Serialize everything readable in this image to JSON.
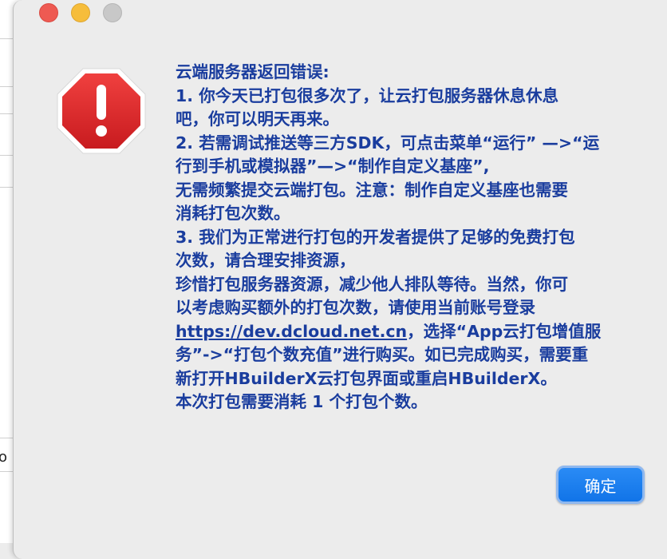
{
  "window": {
    "controls": [
      "close",
      "minimize",
      "zoom"
    ]
  },
  "background": {
    "partial_letter": "o"
  },
  "alert": {
    "icon": "stop-warning-icon",
    "lines": [
      {
        "text": "云端服务器返回错误:"
      },
      {
        "text": "1. 你今天已打包很多次了，让云打包服务器休息休息"
      },
      {
        "text": "吧，你可以明天再来。"
      },
      {
        "text": "2. 若需调试推送等三方SDK，可点击菜单“运行” —>“运"
      },
      {
        "text": "行到手机或模拟器”—>“制作自定义基座”,"
      },
      {
        "text": "无需频繁提交云端打包。注意：制作自定义基座也需要"
      },
      {
        "text": "消耗打包次数。"
      },
      {
        "text": "3. 我们为正常进行打包的开发者提供了足够的免费打包"
      },
      {
        "text": "次数，请合理安排资源，"
      },
      {
        "text": "珍惜打包服务器资源，减少他人排队等待。当然，你可"
      },
      {
        "text": "以考虑购买额外的打包次数，请使用当前账号登录"
      }
    ],
    "link_line": {
      "link": "https://dev.dcloud.net.cn",
      "after": "，选择“App云打包增值服"
    },
    "tail_lines": [
      {
        "text": "务”->“打包个数充值”进行购买。如已完成购买，需要重"
      },
      {
        "text": "新打开HBuilderX云打包界面或重启HBuilderX。"
      },
      {
        "text": "本次打包需要消耗 1 个打包个数。"
      }
    ]
  },
  "buttons": {
    "ok_label": "确定"
  },
  "colors": {
    "message_text": "#1a3d9e",
    "button_blue": "#1a7ef0",
    "stop_red": "#e0262a"
  }
}
